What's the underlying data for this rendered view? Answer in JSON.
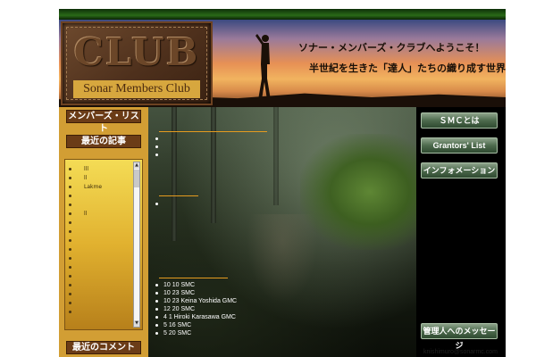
{
  "header": {
    "logo_title": "CLUB",
    "logo_subtitle": "Sonar Members Club",
    "welcome": "ソナー・メンバーズ・クラブへようこそ！",
    "tagline": "半世紀を生きた「達人」たちの織り成す世界へ"
  },
  "sidebar": {
    "members_list_label": "メンバーズ・リスト",
    "recent_articles_label": "最近の記事",
    "recent_comments_label": "最近のコメント",
    "recent_items": [
      "lll",
      "ll",
      "Lakme",
      "",
      "",
      "ll",
      "",
      "",
      "",
      "",
      "",
      "",
      "",
      "",
      "",
      "",
      ""
    ]
  },
  "main": {
    "section1_title": "　　　　　　　　　　　",
    "section1_items": [
      "",
      "",
      ""
    ],
    "section2_title": "　　　　",
    "section2_items": [
      ""
    ],
    "section3_title": "　　　　　　　",
    "section3_items": [
      "10 10          SMC",
      "10 23          SMC",
      "10 23   Keina Yoshida   GMC",
      "12 20          SMC",
      "4 1    Hiroki Karasawa   GMC",
      "5 16          SMC",
      "5 20          SMC"
    ]
  },
  "rightnav": {
    "smc_about": "ＳＭＣとは",
    "grantors_list": "Grantors' List",
    "information": "インフォメーション",
    "admin_message": "管理人へのメッセージ"
  },
  "footer": {
    "email": "knishimuro@sonarmc.com"
  },
  "colors": {
    "link_orange": "#e59b1f",
    "sidebar_gold": "#d29e34",
    "button_brown": "#6b3c17",
    "button_green": "#4d6a4d"
  }
}
